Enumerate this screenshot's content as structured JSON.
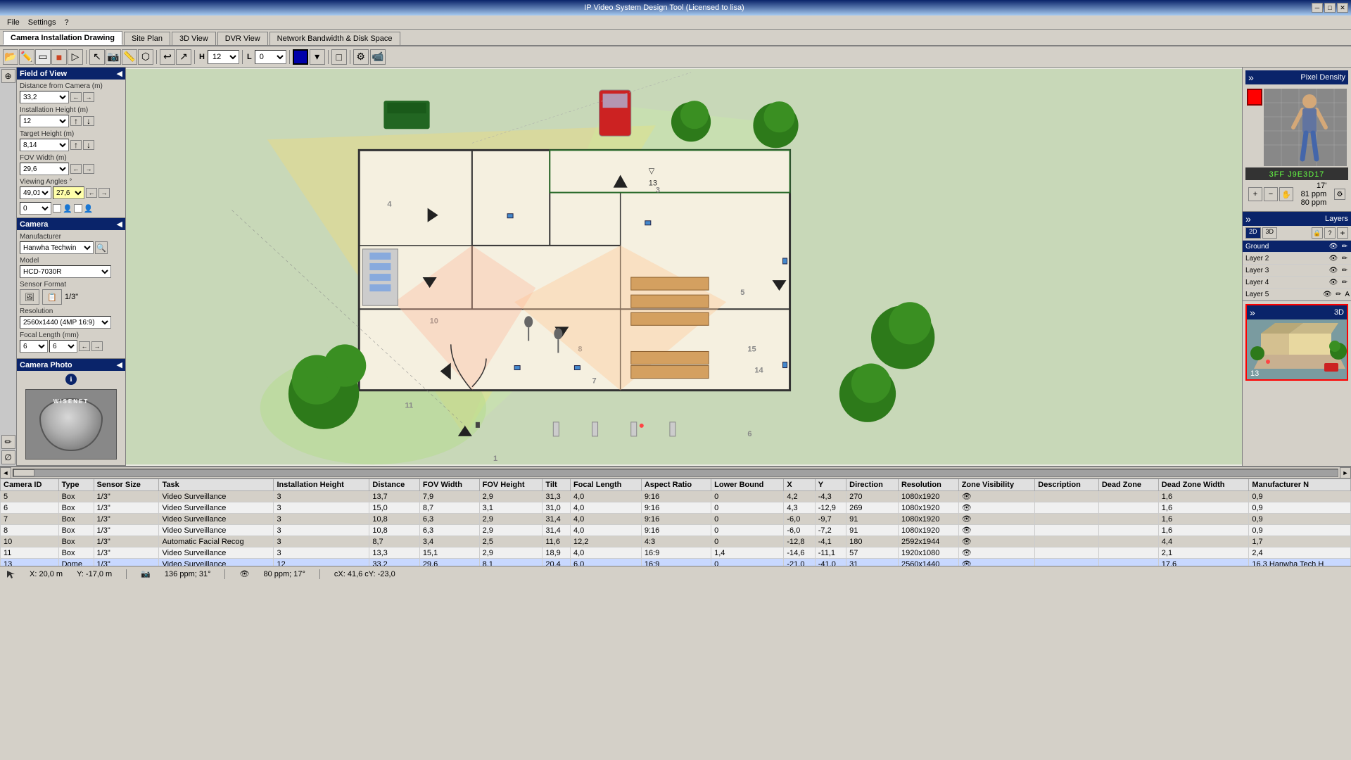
{
  "window": {
    "title": "IP Video System Design Tool (Licensed to lisa)",
    "controls": [
      "minimize",
      "restore",
      "close"
    ]
  },
  "menu": {
    "items": [
      "File",
      "Settings",
      "?"
    ]
  },
  "tabs": {
    "items": [
      "Camera Installation Drawing",
      "Site Plan",
      "3D View",
      "DVR View",
      "Network Bandwidth & Disk Space"
    ],
    "active": "Camera Installation Drawing"
  },
  "toolbar": {
    "height_label": "H",
    "height_value": "12",
    "length_label": "L",
    "length_value": "0"
  },
  "left_panel": {
    "fov_section": {
      "title": "Field of View",
      "distance_label": "Distance from Camera (m)",
      "distance_value": "33,2",
      "installation_height_label": "Installation Height (m)",
      "installation_height_value": "12",
      "target_height_label": "Target Height (m)",
      "target_height_value": "8,14",
      "fov_width_label": "FOV Width (m)",
      "fov_width_value": "29,6",
      "viewing_angles_label": "Viewing Angles °",
      "viewing_angle_h": "49,01",
      "viewing_angle_v": "27,6"
    },
    "camera_section": {
      "title": "Camera",
      "manufacturer_label": "Manufacturer",
      "manufacturer_value": "Hanwha Techwin",
      "model_label": "Model",
      "model_value": "HCD-7030R",
      "sensor_format_label": "Sensor Format",
      "sensor_value": "1/3\"",
      "resolution_label": "Resolution",
      "resolution_value": "2560x1440 (4MP 16:9)",
      "focal_length_label": "Focal Length (mm)",
      "focal_value1": "6",
      "focal_value2": "6"
    },
    "camera_photo": {
      "title": "Camera Photo"
    }
  },
  "right_panel": {
    "pixel_density": {
      "title": "Pixel Density",
      "display_text": "3FF J9E3D17",
      "distance_label": "17'",
      "ppm1": "81 ppm",
      "ppm2": "80 ppm"
    },
    "layers": {
      "title": "Layers",
      "items": [
        {
          "name": "Ground",
          "active": true
        },
        {
          "name": "Layer 2",
          "active": false
        },
        {
          "name": "Layer 3",
          "active": false
        },
        {
          "name": "Layer 4",
          "active": false
        },
        {
          "name": "Layer 5",
          "active": false
        }
      ]
    },
    "view_3d": {
      "title": "3D",
      "label": "13"
    }
  },
  "status_bar": {
    "position_x": "X: 20,0 m",
    "position_y": "Y: -17,0 m",
    "pixel_info": "136 ppm; 31°",
    "ppm_info": "80 ppm; 17°",
    "coord": "cX: 41,6 cY: -23,0"
  },
  "table": {
    "headers": [
      "Camera ID",
      "Type",
      "Sensor Size",
      "Task",
      "Installation Height",
      "Distance",
      "FOV Width",
      "FOV Height",
      "Tilt",
      "Focal Length",
      "Aspect Ratio",
      "Lower Bound",
      "X",
      "Y",
      "Direction",
      "Resolution",
      "Zone Visibility",
      "Description",
      "Dead Zone",
      "Dead Zone Width",
      "Manufacturer N"
    ],
    "rows": [
      {
        "id": "5",
        "type": "Box",
        "sensor": "1/3\"",
        "task": "Video Surveillance",
        "install_h": "3",
        "distance": "13,7",
        "fov_w": "7,9",
        "fov_h": "2,9",
        "tilt": "31,3",
        "focal": "4,0",
        "aspect": "9:16",
        "lower": "0",
        "x": "4,2",
        "y": "-4,3",
        "direction": "270",
        "resolution": "1080x1920",
        "zone_vis": "👁",
        "desc": "",
        "dead_zone": "",
        "dead_zone_w": "1,6",
        "mfr": "0,9"
      },
      {
        "id": "6",
        "type": "Box",
        "sensor": "1/3\"",
        "task": "Video Surveillance",
        "install_h": "3",
        "distance": "15,0",
        "fov_w": "8,7",
        "fov_h": "3,1",
        "tilt": "31,0",
        "focal": "4,0",
        "aspect": "9:16",
        "lower": "0",
        "x": "4,3",
        "y": "-12,9",
        "direction": "269",
        "resolution": "1080x1920",
        "zone_vis": "👁",
        "desc": "",
        "dead_zone": "",
        "dead_zone_w": "1,6",
        "mfr": "0,9"
      },
      {
        "id": "7",
        "type": "Box",
        "sensor": "1/3\"",
        "task": "Video Surveillance",
        "install_h": "3",
        "distance": "10,8",
        "fov_w": "6,3",
        "fov_h": "2,9",
        "tilt": "31,4",
        "focal": "4,0",
        "aspect": "9:16",
        "lower": "0",
        "x": "-6,0",
        "y": "-9,7",
        "direction": "91",
        "resolution": "1080x1920",
        "zone_vis": "👁",
        "desc": "",
        "dead_zone": "",
        "dead_zone_w": "1,6",
        "mfr": "0,9"
      },
      {
        "id": "8",
        "type": "Box",
        "sensor": "1/3\"",
        "task": "Video Surveillance",
        "install_h": "3",
        "distance": "10,8",
        "fov_w": "6,3",
        "fov_h": "2,9",
        "tilt": "31,4",
        "focal": "4,0",
        "aspect": "9:16",
        "lower": "0",
        "x": "-6,0",
        "y": "-7,2",
        "direction": "91",
        "resolution": "1080x1920",
        "zone_vis": "👁",
        "desc": "",
        "dead_zone": "",
        "dead_zone_w": "1,6",
        "mfr": "0,9"
      },
      {
        "id": "10",
        "type": "Box",
        "sensor": "1/3\"",
        "task": "Automatic Facial Recog",
        "install_h": "3",
        "distance": "8,7",
        "fov_w": "3,4",
        "fov_h": "2,5",
        "tilt": "11,6",
        "focal": "12,2",
        "aspect": "4:3",
        "lower": "0",
        "x": "-12,8",
        "y": "-4,1",
        "direction": "180",
        "resolution": "2592x1944",
        "zone_vis": "👁",
        "desc": "",
        "dead_zone": "",
        "dead_zone_w": "4,4",
        "mfr": "1,7"
      },
      {
        "id": "11",
        "type": "Box",
        "sensor": "1/3\"",
        "task": "Video Surveillance",
        "install_h": "3",
        "distance": "13,3",
        "fov_w": "15,1",
        "fov_h": "2,9",
        "tilt": "18,9",
        "focal": "4,0",
        "aspect": "16:9",
        "lower": "1,4",
        "x": "-14,6",
        "y": "-11,1",
        "direction": "57",
        "resolution": "1920x1080",
        "zone_vis": "👁",
        "desc": "",
        "dead_zone": "",
        "dead_zone_w": "2,1",
        "mfr": "2,4"
      },
      {
        "id": "13",
        "type": "Dome",
        "sensor": "1/3\"",
        "task": "Video Surveillance",
        "install_h": "12",
        "distance": "33,2",
        "fov_w": "29,6",
        "fov_h": "8,1",
        "tilt": "20,4",
        "focal": "6,0",
        "aspect": "16:9",
        "lower": "0",
        "x": "-21,0",
        "y": "-41,0",
        "direction": "31",
        "resolution": "2560x1440",
        "zone_vis": "👁",
        "desc": "",
        "dead_zone": "",
        "dead_zone_w": "17,6",
        "mfr": "16,3 Hanwha Tech H"
      }
    ]
  },
  "canvas": {
    "zoom": "20",
    "bg_color": "#c8d8b8"
  }
}
